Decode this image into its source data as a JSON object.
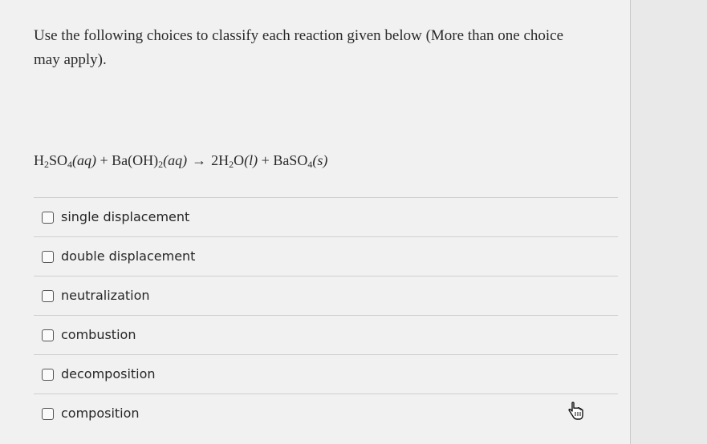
{
  "question": {
    "prompt_line1": "Use the following choices to classify each reaction given below (More than one choice",
    "prompt_line2": "may apply).",
    "equation": {
      "h2so4_H": "H",
      "h2so4_2": "2",
      "h2so4_SO": "SO",
      "h2so4_4": "4",
      "h2so4_state": "(aq)",
      "plus1": " + ",
      "baoh_text": "Ba(OH)",
      "baoh_2": "2",
      "baoh_state": "(aq)",
      "arrow": "→",
      "water_2H": "2H",
      "water_2": "2",
      "water_O": "O",
      "water_state": "(l)",
      "plus2": " + ",
      "baso4_text": "BaSO",
      "baso4_4": "4",
      "baso4_state": "(s)"
    }
  },
  "choices": [
    {
      "label": "single displacement",
      "checked": false
    },
    {
      "label": "double displacement",
      "checked": false
    },
    {
      "label": "neutralization",
      "checked": false
    },
    {
      "label": "combustion",
      "checked": false
    },
    {
      "label": "decomposition",
      "checked": false
    },
    {
      "label": "composition",
      "checked": false
    }
  ],
  "cursor_icon": "hand-pointer-icon"
}
